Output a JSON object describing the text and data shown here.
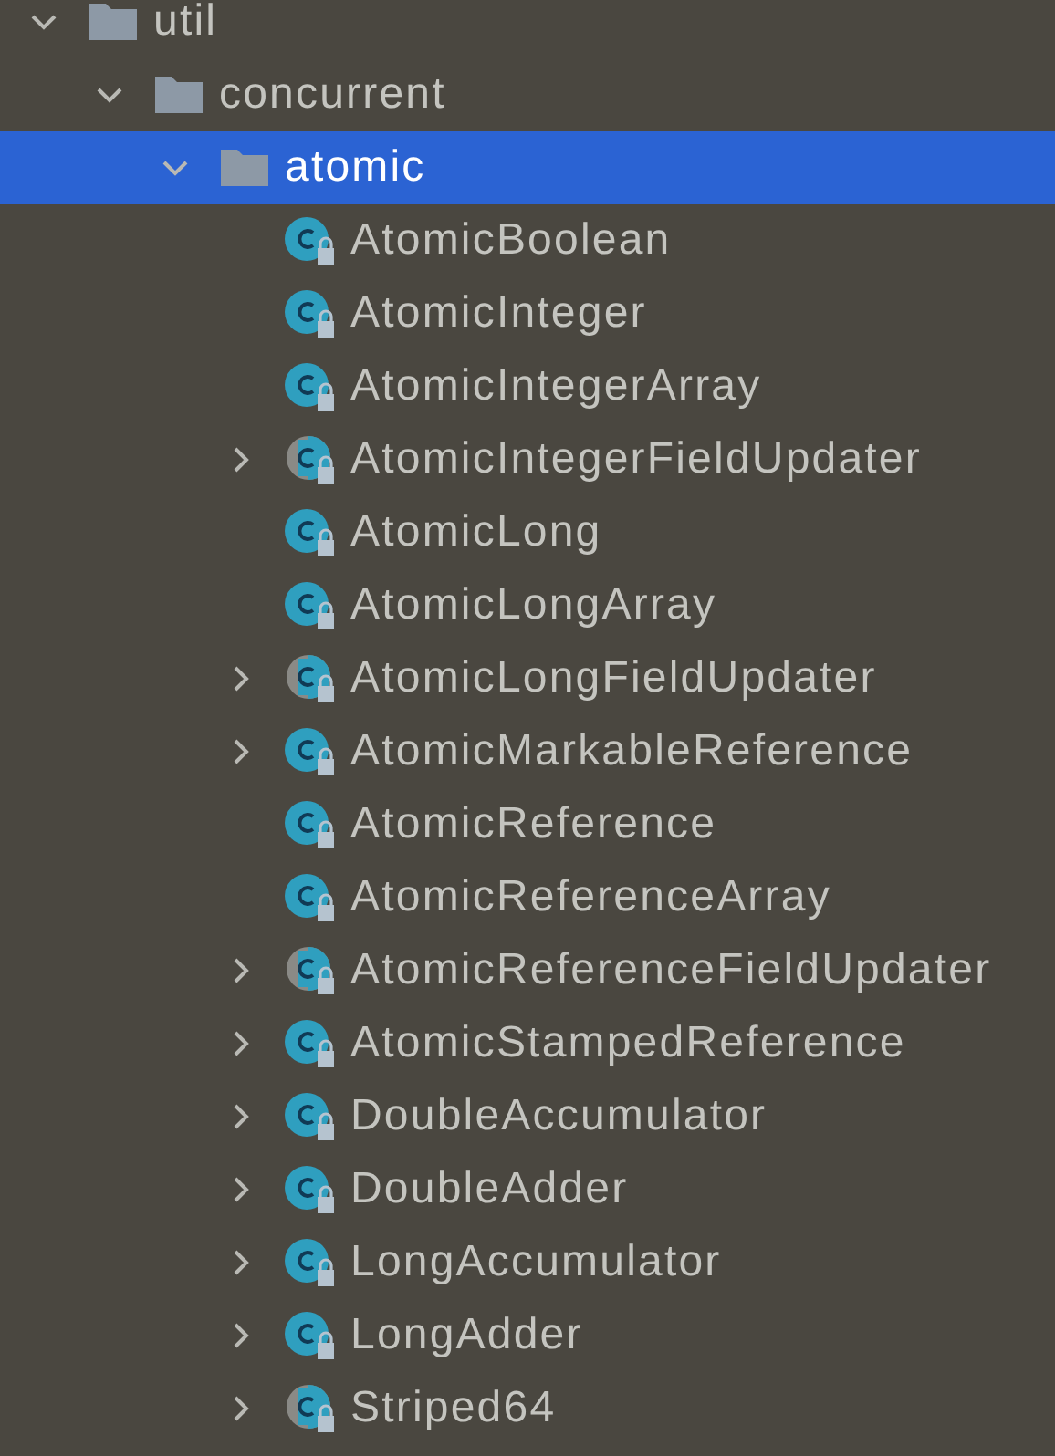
{
  "tree": [
    {
      "label": "util",
      "kind": "folder",
      "expanded": true,
      "selected": false,
      "children": [
        {
          "label": "concurrent",
          "kind": "folder",
          "expanded": true,
          "selected": false,
          "children": [
            {
              "label": "atomic",
              "kind": "folder",
              "expanded": true,
              "selected": true,
              "children": [
                {
                  "label": "AtomicBoolean",
                  "kind": "class",
                  "expandable": false,
                  "selected": false
                },
                {
                  "label": "AtomicInteger",
                  "kind": "class",
                  "expandable": false,
                  "selected": false
                },
                {
                  "label": "AtomicIntegerArray",
                  "kind": "class",
                  "expandable": false,
                  "selected": false
                },
                {
                  "label": "AtomicIntegerFieldUpdater",
                  "kind": "abstract",
                  "expandable": true,
                  "selected": false
                },
                {
                  "label": "AtomicLong",
                  "kind": "class",
                  "expandable": false,
                  "selected": false
                },
                {
                  "label": "AtomicLongArray",
                  "kind": "class",
                  "expandable": false,
                  "selected": false
                },
                {
                  "label": "AtomicLongFieldUpdater",
                  "kind": "abstract",
                  "expandable": true,
                  "selected": false
                },
                {
                  "label": "AtomicMarkableReference",
                  "kind": "class",
                  "expandable": true,
                  "selected": false
                },
                {
                  "label": "AtomicReference",
                  "kind": "class",
                  "expandable": false,
                  "selected": false
                },
                {
                  "label": "AtomicReferenceArray",
                  "kind": "class",
                  "expandable": false,
                  "selected": false
                },
                {
                  "label": "AtomicReferenceFieldUpdater",
                  "kind": "abstract",
                  "expandable": true,
                  "selected": false
                },
                {
                  "label": "AtomicStampedReference",
                  "kind": "class",
                  "expandable": true,
                  "selected": false
                },
                {
                  "label": "DoubleAccumulator",
                  "kind": "class",
                  "expandable": true,
                  "selected": false
                },
                {
                  "label": "DoubleAdder",
                  "kind": "class",
                  "expandable": true,
                  "selected": false
                },
                {
                  "label": "LongAccumulator",
                  "kind": "class",
                  "expandable": true,
                  "selected": false
                },
                {
                  "label": "LongAdder",
                  "kind": "class",
                  "expandable": true,
                  "selected": false
                },
                {
                  "label": "Striped64",
                  "kind": "abstract",
                  "expandable": true,
                  "selected": false
                }
              ]
            }
          ]
        }
      ]
    }
  ]
}
